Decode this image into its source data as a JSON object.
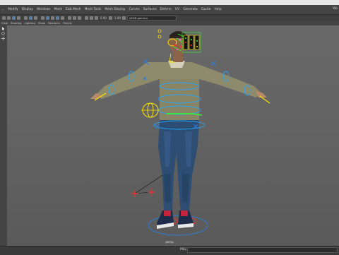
{
  "menubar": {
    "items": [
      "...",
      "Modify",
      "Display",
      "Windows",
      "Mesh",
      "Edit Mesh",
      "Mesh Tools",
      "Mesh Display",
      "Curves",
      "Surfaces",
      "Deform",
      "UV",
      "Generate",
      "Cache",
      "Help"
    ],
    "workspace": "Wo"
  },
  "shelf": {
    "time_field": "0.00",
    "scale_field": "1.00",
    "camera_select": "sRGB gamma"
  },
  "panel_menu": {
    "items": [
      "View",
      "Shading",
      "Lighting",
      "Show",
      "Renderer",
      "Panels"
    ]
  },
  "viewport": {
    "camera_label": "persp"
  },
  "command_line": {
    "label": "MEL"
  },
  "colors": {
    "viewport_bg": "#646464",
    "ik_control": "#22a6ff",
    "fk_control": "#ffe600",
    "joint_red": "#ff2a2a",
    "sweater": "#8e8a6c",
    "jeans": "#2d4d73"
  }
}
